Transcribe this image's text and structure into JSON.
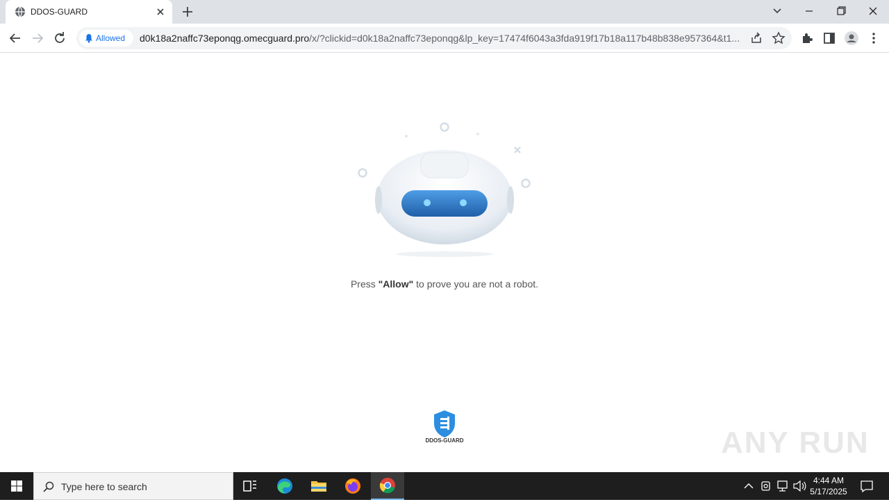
{
  "browser": {
    "tab": {
      "title": "DDOS-GUARD"
    },
    "address_bar": {
      "permission_chip": "Allowed",
      "url_host": "d0k18a2naffc73eponqg.omecguard.pro",
      "url_rest": "/x/?clickid=d0k18a2naffc73eponqg&lp_key=17474f6043a3fda919f17b18a117b48b838e957364&t1..."
    }
  },
  "page": {
    "message_prefix": "Press ",
    "message_bold": "\"Allow\"",
    "message_suffix": " to prove you are not a robot.",
    "brand_name": "DDOS-GUARD",
    "watermark": "ANY RUN"
  },
  "taskbar": {
    "search_placeholder": "Type here to search",
    "time": "4:44 AM",
    "date": "5/17/2025"
  },
  "colors": {
    "accent": "#1a73e8",
    "robot_visor": "#2a7fd4",
    "shield": "#2d8ee0"
  }
}
